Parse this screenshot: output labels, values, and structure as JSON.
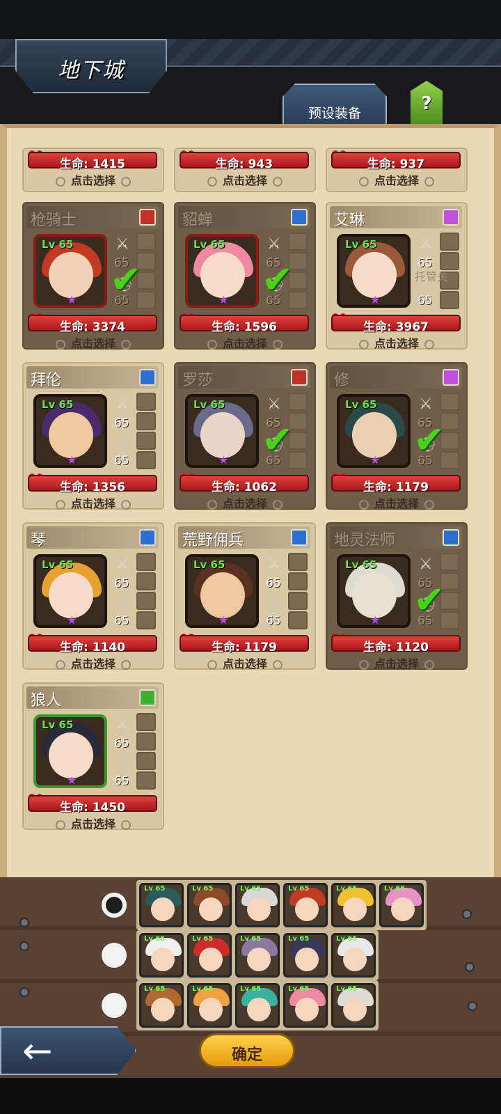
{
  "header": {
    "title": "地下城",
    "preset_label": "预设装备",
    "help_label": "?"
  },
  "top_row": [
    {
      "hp": "生命: 1415",
      "select": "点击选择"
    },
    {
      "hp": "生命: 943",
      "select": "点击选择"
    },
    {
      "hp": "生命: 937",
      "select": "点击选择"
    }
  ],
  "heroes": [
    {
      "name": "枪骑士",
      "lv": "Lv 65",
      "n1": "65",
      "n2": "65",
      "hp": "生命: 3374",
      "select": "点击选择",
      "selected": true,
      "gem": "#c0302a",
      "hair": "#c23a24",
      "face": "#f3d0b5",
      "frame": "#8a1a14"
    },
    {
      "name": "貂蝉",
      "lv": "Lv 65",
      "n1": "65",
      "n2": "65",
      "hp": "生命: 1596",
      "select": "点击选择",
      "selected": true,
      "gem": "#2d6fd0",
      "hair": "#f08aa2",
      "face": "#f6dbc8",
      "frame": "#8a1a14"
    },
    {
      "name": "艾琳",
      "lv": "Lv 65",
      "n1": "65",
      "n2": "65",
      "hp": "生命: 3967",
      "select": "点击选择",
      "selected": false,
      "gem": "#c250d8",
      "hair": "#9a5a3a",
      "face": "#f6dbc8",
      "frame": "#1e140d"
    },
    {
      "name": "拜伦",
      "lv": "Lv 65",
      "n1": "65",
      "n2": "65",
      "hp": "生命: 1356",
      "select": "点击选择",
      "selected": false,
      "gem": "#2d6fd0",
      "hair": "#4a2a6a",
      "face": "#f0c8a0",
      "frame": "#1e140d"
    },
    {
      "name": "罗莎",
      "lv": "Lv 65",
      "n1": "65",
      "n2": "65",
      "hp": "生命: 1062",
      "select": "点击选择",
      "selected": true,
      "gem": "#c0302a",
      "hair": "#6a6a8a",
      "face": "#e8d4c8",
      "frame": "#1e140d"
    },
    {
      "name": "修",
      "lv": "Lv 65",
      "n1": "65",
      "n2": "65",
      "hp": "生命: 1179",
      "select": "点击选择",
      "selected": true,
      "gem": "#c250d8",
      "hair": "#2a4a4a",
      "face": "#e8d0b0",
      "frame": "#1e140d"
    },
    {
      "name": "琴",
      "lv": "Lv 65",
      "n1": "65",
      "n2": "65",
      "hp": "生命: 1140",
      "select": "点击选择",
      "selected": false,
      "gem": "#2d6fd0",
      "hair": "#e8a030",
      "face": "#f6dbc8",
      "frame": "#1e140d"
    },
    {
      "name": "荒野佣兵",
      "lv": "Lv 65",
      "n1": "65",
      "n2": "65",
      "hp": "生命: 1179",
      "select": "点击选择",
      "selected": false,
      "gem": "#2d6fd0",
      "hair": "#5a3020",
      "face": "#f0c8a0",
      "frame": "#1e140d"
    },
    {
      "name": "地灵法师",
      "lv": "Lv 65",
      "n1": "65",
      "n2": "65",
      "hp": "生命: 1120",
      "select": "点击选择",
      "selected": true,
      "gem": "#2d6fd0",
      "hair": "#dcdcd0",
      "face": "#e8e0d0",
      "frame": "#1e140d"
    },
    {
      "name": "狼人",
      "lv": "Lv 65",
      "n1": "65",
      "n2": "65",
      "hp": "生命: 1450",
      "select": "点击选择",
      "selected": false,
      "gem": "#3ab030",
      "hair": "#2a2a3a",
      "face": "#f6dbc8",
      "frame": "#3a9a2a"
    }
  ],
  "trust_label": "托管关",
  "teams": [
    {
      "active": true,
      "members": [
        {
          "lv": "Lv 65",
          "hair": "#2a5a5a"
        },
        {
          "lv": "Lv 65",
          "hair": "#8a4a2a"
        },
        {
          "lv": "Lv 65",
          "hair": "#d8d8d8"
        },
        {
          "lv": "Lv 65",
          "hair": "#c23a24"
        },
        {
          "lv": "Lv 65",
          "hair": "#f0c030"
        },
        {
          "lv": "Lv 65",
          "hair": "#e890c8"
        }
      ]
    },
    {
      "active": false,
      "members": [
        {
          "lv": "Lv 65",
          "hair": "#f0f0f0"
        },
        {
          "lv": "Lv 65",
          "hair": "#d02a2a"
        },
        {
          "lv": "Lv 65",
          "hair": "#8a7aa0"
        },
        {
          "lv": "Lv 65",
          "hair": "#3a3a5a"
        },
        {
          "lv": "Lv 65",
          "hair": "#e8e8e8"
        }
      ]
    },
    {
      "active": false,
      "members": [
        {
          "lv": "Lv 65",
          "hair": "#b06a30"
        },
        {
          "lv": "Lv 65",
          "hair": "#f0a040"
        },
        {
          "lv": "Lv 65",
          "hair": "#3ab0a0"
        },
        {
          "lv": "Lv 65",
          "hair": "#f08aa2"
        },
        {
          "lv": "Lv 65",
          "hair": "#dcdcd0"
        }
      ]
    }
  ],
  "confirm_label": "确定",
  "back_icon": "←"
}
